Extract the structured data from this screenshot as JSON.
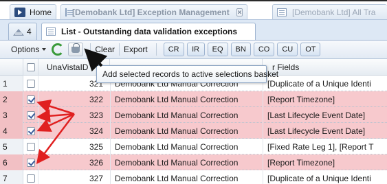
{
  "top_tabs": {
    "home": "Home",
    "exceptions": "[Demobank Ltd] Exception Management",
    "all": "[Demobank Ltd] All Tra"
  },
  "sub_tabs": {
    "count": "4",
    "list": "List - Outstanding data validation exceptions"
  },
  "toolbar": {
    "options": "Options",
    "clear": "Clear",
    "export": "Export",
    "codes": [
      "CR",
      "IR",
      "EQ",
      "BN",
      "CO",
      "CU",
      "OT"
    ]
  },
  "tooltip": "Add selected records to active selections basket",
  "grid": {
    "col_id": "UnaVistaID",
    "col_fields": "r Fields",
    "rows": [
      {
        "num": "1",
        "checked": false,
        "id": "321",
        "name": "Demobank Ltd Manual Correction",
        "fields": "[Duplicate of a Unique Identi"
      },
      {
        "num": "2",
        "checked": true,
        "id": "322",
        "name": "Demobank Ltd Manual Correction",
        "fields": "[Report Timezone]"
      },
      {
        "num": "3",
        "checked": true,
        "id": "323",
        "name": "Demobank Ltd Manual Correction",
        "fields": "[Last Lifecycle Event Date]"
      },
      {
        "num": "4",
        "checked": true,
        "id": "324",
        "name": "Demobank Ltd Manual Correction",
        "fields": "[Last Lifecycle Event Date]"
      },
      {
        "num": "5",
        "checked": false,
        "id": "325",
        "name": "Demobank Ltd Manual Correction",
        "fields": "[Fixed Rate Leg 1], [Report T"
      },
      {
        "num": "6",
        "checked": true,
        "id": "326",
        "name": "Demobank Ltd Manual Correction",
        "fields": "[Report Timezone]"
      },
      {
        "num": "7",
        "checked": false,
        "id": "327",
        "name": "Demobank Ltd Manual Correction",
        "fields": "[Duplicate of a Unique Identi"
      }
    ]
  },
  "colors": {
    "selected_row": "#f7c9cd",
    "arrow_red": "#e02020",
    "tab_blue": "#dde8f5"
  }
}
